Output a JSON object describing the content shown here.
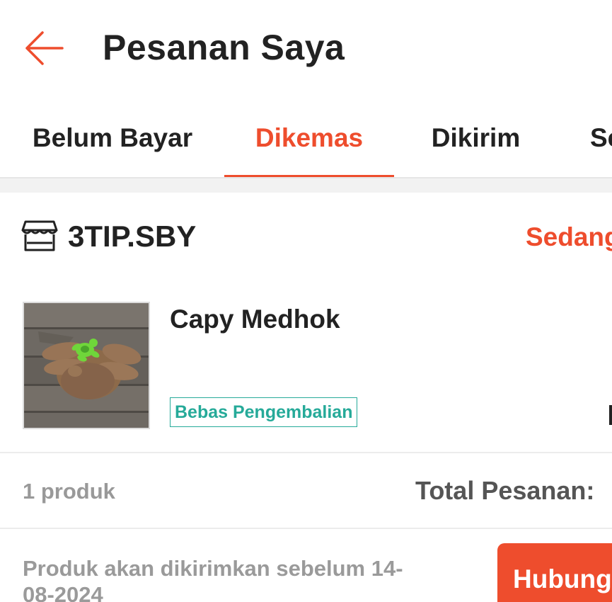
{
  "header": {
    "title": "Pesanan Saya",
    "back_icon": "arrow-left-icon"
  },
  "tabs": [
    {
      "label": "Belum Bayar",
      "active": false
    },
    {
      "label": "Dikemas",
      "active": true
    },
    {
      "label": "Dikirim",
      "active": false
    },
    {
      "label": "Se",
      "active": false
    }
  ],
  "order": {
    "shop_icon": "store-icon",
    "shop_name": "3TIP.SBY",
    "status": "Sedang",
    "product": {
      "name": "Capy Medhok",
      "badge": "Bebas Pengembalian",
      "image_alt": "capybara plush toy"
    },
    "summary": {
      "count": "1 produk",
      "total_label": "Total Pesanan:"
    },
    "ship_note": "Produk akan dikirimkan sebelum 14-08-2024",
    "contact_button": "Hubung"
  },
  "colors": {
    "accent": "#ee4d2d",
    "badge_green": "#26aa99",
    "text_dark": "#222222",
    "text_muted": "#9a9a9a"
  }
}
